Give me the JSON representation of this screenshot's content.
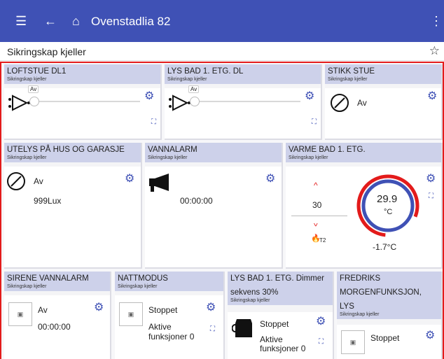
{
  "app": {
    "title": "Ovenstadlia 82",
    "menu_icon": "hamburger-menu-icon",
    "back_icon": "arrow-left-icon",
    "home_icon": "home-icon",
    "more_icon": "more-vert-icon"
  },
  "page": {
    "title": "Sikringskap kjeller",
    "star_icon": "star-outline-icon"
  },
  "colors": {
    "appbar": "#3f51b5",
    "accent": "#3f51b5",
    "highlight": "#e31b1b",
    "card_header": "#cdd1ea"
  },
  "cards": {
    "loftstue": {
      "name": "LOFTSTUE DL1",
      "room": "Sikringskap kjeller",
      "slider_label": "Av"
    },
    "lys_bad_dl": {
      "name": "LYS BAD 1. ETG. DL",
      "room": "Sikringskap kjeller",
      "slider_label": "Av"
    },
    "stikk_stue": {
      "name": "STIKK STUE",
      "room": "Sikringskap kjeller",
      "state": "Av"
    },
    "utelys": {
      "name": "UTELYS PÅ HUS OG GARASJE",
      "room": "Sikringskap kjeller",
      "state": "Av",
      "lux": "999Lux"
    },
    "vannalarm": {
      "name": "VANNALARM",
      "room": "Sikringskap kjeller",
      "time": "00:00:00"
    },
    "varme_bad": {
      "name": "VARME BAD 1. ETG.",
      "room": "Sikringskap kjeller",
      "setpoint": "30",
      "temp": "29.9",
      "unit": "°C",
      "outdoor": "-1.7°C",
      "sensor_label": "T2"
    },
    "sirene": {
      "name": "SIRENE VANNALARM",
      "room": "Sikringskap kjeller",
      "state": "Av",
      "time": "00:00:00"
    },
    "nattmodus": {
      "name": "NATTMODUS",
      "room": "Sikringskap kjeller",
      "state": "Stoppet",
      "active_line1": "Aktive",
      "active_line2": "funksjoner 0"
    },
    "lys_bad_dimmer": {
      "name": "LYS BAD 1. ETG. Dimmer",
      "sub_value": "sekvens 30%",
      "room": "Sikringskap kjeller",
      "state": "Stoppet",
      "active_line1": "Aktive",
      "active_line2": "funksjoner 0"
    },
    "fredriks": {
      "name_line1": "FREDRIKS",
      "name_line2": "MORGENFUNKSJON,",
      "name_line3": "LYS",
      "room": "Sikringskap kjeller",
      "state": "Stoppet"
    }
  }
}
